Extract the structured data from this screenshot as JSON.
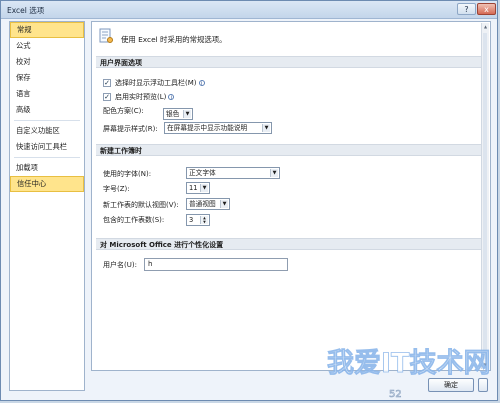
{
  "window": {
    "title": "Excel 选项",
    "help_glyph": "?",
    "close_glyph": "x"
  },
  "sidebar": {
    "items": [
      {
        "label": "常规",
        "selected": true
      },
      {
        "label": "公式"
      },
      {
        "label": "校对"
      },
      {
        "label": "保存"
      },
      {
        "label": "语言"
      },
      {
        "label": "高级"
      },
      {
        "label": "自定义功能区"
      },
      {
        "label": "快速访问工具栏"
      },
      {
        "label": "加载项"
      },
      {
        "label": "信任中心",
        "selected": true
      }
    ]
  },
  "content": {
    "header_text": "使用 Excel 时采用的常规选项。",
    "ui_section": {
      "title": "用户界面选项",
      "show_mini_toolbar": {
        "label": "选择时显示浮动工具栏(M)",
        "checked": true
      },
      "live_preview": {
        "label": "启用实时预览(L)",
        "checked": true
      },
      "color_scheme_label": "配色方案(C):",
      "color_scheme_value": "银色",
      "tooltip_style_label": "屏幕提示样式(R):",
      "tooltip_style_value": "在屏幕提示中显示功能说明"
    },
    "workbook_section": {
      "title": "新建工作簿时",
      "font_label": "使用的字体(N):",
      "font_value": "正文字体",
      "font_size_label": "字号(Z):",
      "font_size_value": "11",
      "default_view_label": "新工作表的默认视图(V):",
      "default_view_value": "普通视图",
      "sheet_count_label": "包含的工作表数(S):",
      "sheet_count_value": "3"
    },
    "personalize_section": {
      "title": "对 Microsoft Office 进行个性化设置",
      "username_label": "用户名(U):",
      "username_value": "h"
    }
  },
  "footer": {
    "ok_label": "确定",
    "cancel_label": ""
  },
  "watermark": {
    "text": "我爱IT技术网",
    "sub": "52"
  },
  "colors": {
    "selected_bg": "#ffe48c",
    "section_bg": "#e6ebf1",
    "window_bg": "#eef3fa"
  }
}
